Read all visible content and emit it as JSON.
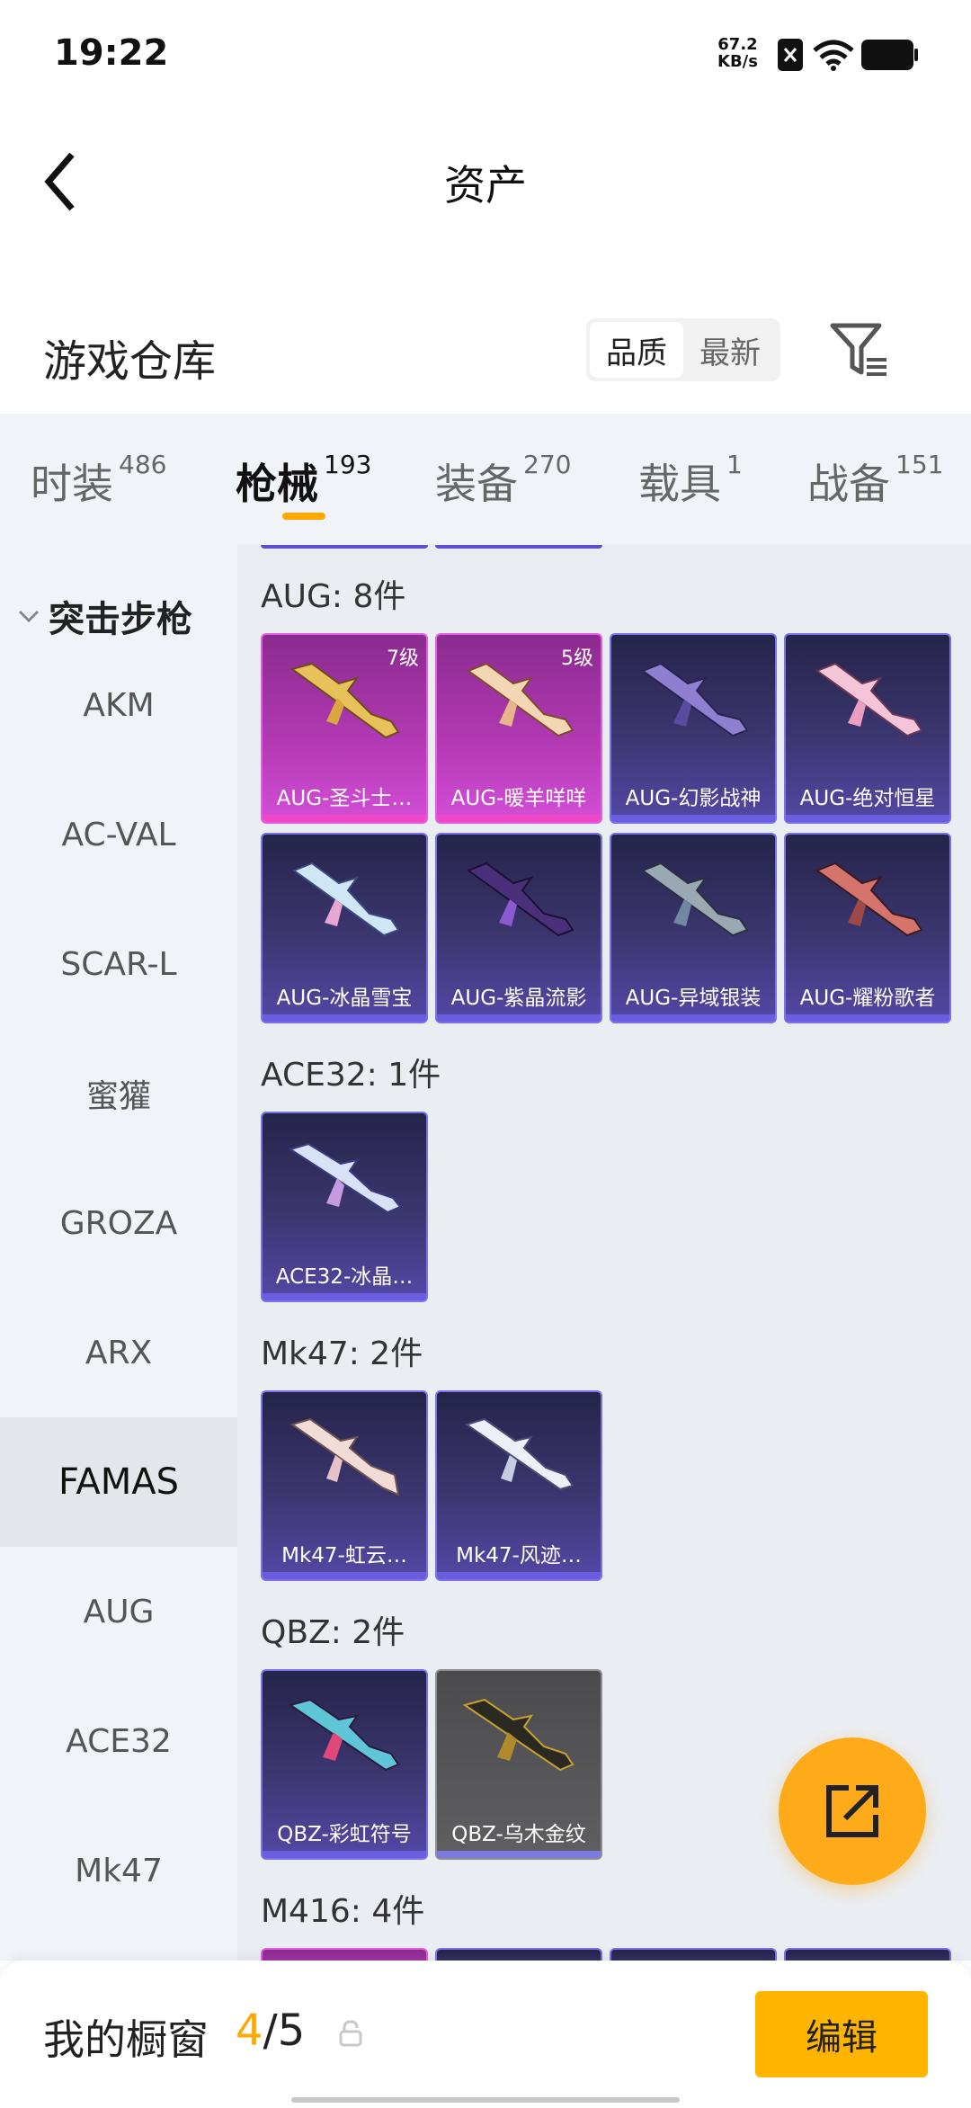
{
  "status_bar": {
    "time": "19:22",
    "net_speed_value": "67.2",
    "net_speed_unit": "KB/s",
    "icons": [
      "sim-blocked-icon",
      "wifi-icon",
      "battery-icon"
    ]
  },
  "header": {
    "title": "资产",
    "back_icon": "back-arrow-icon"
  },
  "warehouse": {
    "title": "游戏仓库",
    "sort_options": [
      "品质",
      "最新"
    ],
    "sort_selected": "品质",
    "filter_icon": "filter-icon"
  },
  "tabs": [
    {
      "label": "时装",
      "count": "486"
    },
    {
      "label": "枪械",
      "count": "193",
      "active": true
    },
    {
      "label": "装备",
      "count": "270"
    },
    {
      "label": "载具",
      "count": "1"
    },
    {
      "label": "战备",
      "count": "151"
    }
  ],
  "sidebar": {
    "category": "突击步枪",
    "items": [
      "AKM",
      "AC-VAL",
      "SCAR-L",
      "蜜獾",
      "GROZA",
      "ARX",
      "FAMAS",
      "AUG",
      "ACE32",
      "Mk47"
    ],
    "selected": "FAMAS"
  },
  "groups": [
    {
      "label": "AUG: 8件",
      "items": [
        {
          "name": "AUG-圣斗士…",
          "level": "7级",
          "rarity": "pink"
        },
        {
          "name": "AUG-暖羊咩咩",
          "level": "5级",
          "rarity": "pink"
        },
        {
          "name": "AUG-幻影战神",
          "rarity": "purple"
        },
        {
          "name": "AUG-绝对恒星",
          "rarity": "purple"
        },
        {
          "name": "AUG-冰晶雪宝",
          "rarity": "purple"
        },
        {
          "name": "AUG-紫晶流影",
          "rarity": "purple"
        },
        {
          "name": "AUG-异域银装",
          "rarity": "purple"
        },
        {
          "name": "AUG-耀粉歌者",
          "rarity": "purple"
        }
      ]
    },
    {
      "label": "ACE32: 1件",
      "items": [
        {
          "name": "ACE32-冰晶…",
          "rarity": "purple"
        }
      ]
    },
    {
      "label": "Mk47: 2件",
      "items": [
        {
          "name": "Mk47-虹云…",
          "rarity": "purple"
        },
        {
          "name": "Mk47-风迹…",
          "rarity": "purple"
        }
      ]
    },
    {
      "label": "QBZ: 2件",
      "items": [
        {
          "name": "QBZ-彩虹符号",
          "rarity": "purple"
        },
        {
          "name": "QBZ-乌木金纹",
          "rarity": "gray"
        }
      ]
    },
    {
      "label": "M416: 4件",
      "items": []
    }
  ],
  "share_icon": "share-external-icon",
  "bottom_bar": {
    "label": "我的橱窗",
    "current": "4",
    "separator": "/",
    "total": "5",
    "lock_icon": "lock-icon",
    "edit_label": "编辑"
  },
  "colors": {
    "accent": "#ffa800",
    "purple_quality": "#5448a6",
    "pink_quality": "#d44fd8"
  }
}
